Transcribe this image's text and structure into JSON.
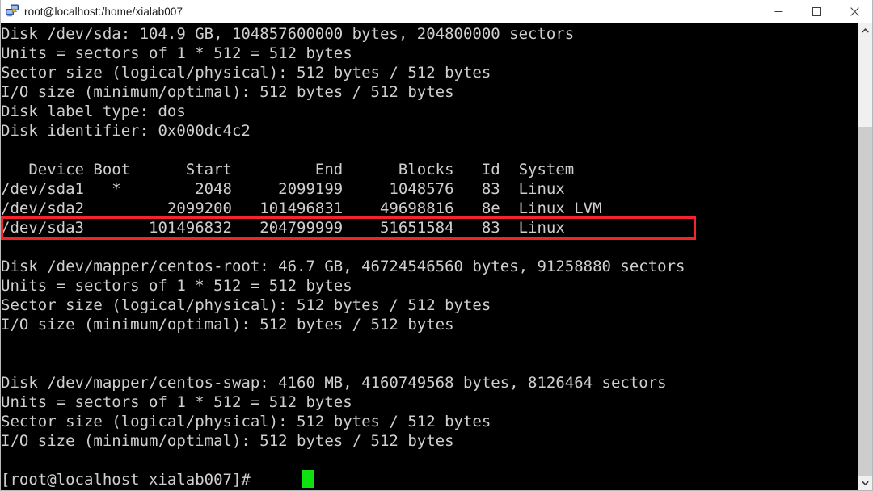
{
  "window": {
    "title": "root@localhost:/home/xialab007",
    "icon": "remote-computers-icon",
    "controls": {
      "minimize": "minimize-icon",
      "maximize": "maximize-icon",
      "close": "close-icon"
    }
  },
  "colors": {
    "terminal_background": "#000000",
    "terminal_foreground": "#cfcfcf",
    "cursor": "#10e010",
    "highlight_box": "#f5242a",
    "titlebar_background": "#ffffff",
    "scrollbar_track": "#cdcdcd",
    "scrollbar_thumb": "#f0f0f0"
  },
  "terminal": {
    "lines": [
      "Disk /dev/sda: 104.9 GB, 104857600000 bytes, 204800000 sectors",
      "Units = sectors of 1 * 512 = 512 bytes",
      "Sector size (logical/physical): 512 bytes / 512 bytes",
      "I/O size (minimum/optimal): 512 bytes / 512 bytes",
      "Disk label type: dos",
      "Disk identifier: 0x000dc4c2",
      "",
      "   Device Boot      Start         End      Blocks   Id  System",
      "/dev/sda1   *        2048     2099199     1048576   83  Linux",
      "/dev/sda2         2099200   101496831    49698816   8e  Linux LVM",
      "/dev/sda3       101496832   204799999    51651584   83  Linux",
      "",
      "Disk /dev/mapper/centos-root: 46.7 GB, 46724546560 bytes, 91258880 sectors",
      "Units = sectors of 1 * 512 = 512 bytes",
      "Sector size (logical/physical): 512 bytes / 512 bytes",
      "I/O size (minimum/optimal): 512 bytes / 512 bytes",
      "",
      "",
      "Disk /dev/mapper/centos-swap: 4160 MB, 4160749568 bytes, 8126464 sectors",
      "Units = sectors of 1 * 512 = 512 bytes",
      "Sector size (logical/physical): 512 bytes / 512 bytes",
      "I/O size (minimum/optimal): 512 bytes / 512 bytes",
      "",
      "[root@localhost xialab007]# "
    ],
    "partition_table": {
      "headers": [
        "Device",
        "Boot",
        "Start",
        "End",
        "Blocks",
        "Id",
        "System"
      ],
      "rows": [
        {
          "device": "/dev/sda1",
          "boot": "*",
          "start": "2048",
          "end": "2099199",
          "blocks": "1048576",
          "id": "83",
          "system": "Linux",
          "highlighted": false
        },
        {
          "device": "/dev/sda2",
          "boot": "",
          "start": "2099200",
          "end": "101496831",
          "blocks": "49698816",
          "id": "8e",
          "system": "Linux LVM",
          "highlighted": false
        },
        {
          "device": "/dev/sda3",
          "boot": "",
          "start": "101496832",
          "end": "204799999",
          "blocks": "51651584",
          "id": "83",
          "system": "Linux",
          "highlighted": true
        }
      ]
    },
    "disks": [
      {
        "name": "/dev/sda",
        "size": "104.9 GB",
        "bytes": "104857600000 bytes",
        "sectors": "204800000 sectors",
        "units": "Units = sectors of 1 * 512 = 512 bytes",
        "sector_size": "Sector size (logical/physical): 512 bytes / 512 bytes",
        "io_size": "I/O size (minimum/optimal): 512 bytes / 512 bytes",
        "label_type": "Disk label type: dos",
        "identifier": "Disk identifier: 0x000dc4c2"
      },
      {
        "name": "/dev/mapper/centos-root",
        "size": "46.7 GB",
        "bytes": "46724546560 bytes",
        "sectors": "91258880 sectors",
        "units": "Units = sectors of 1 * 512 = 512 bytes",
        "sector_size": "Sector size (logical/physical): 512 bytes / 512 bytes",
        "io_size": "I/O size (minimum/optimal): 512 bytes / 512 bytes"
      },
      {
        "name": "/dev/mapper/centos-swap",
        "size": "4160 MB",
        "bytes": "4160749568 bytes",
        "sectors": "8126464 sectors",
        "units": "Units = sectors of 1 * 512 = 512 bytes",
        "sector_size": "Sector size (logical/physical): 512 bytes / 512 bytes",
        "io_size": "I/O size (minimum/optimal): 512 bytes / 512 bytes"
      }
    ],
    "prompt": "[root@localhost xialab007]# ",
    "cursor_visible": true
  },
  "scrollbar": {
    "up_arrow": "chevron-up-icon",
    "down_arrow": "chevron-down-icon"
  }
}
